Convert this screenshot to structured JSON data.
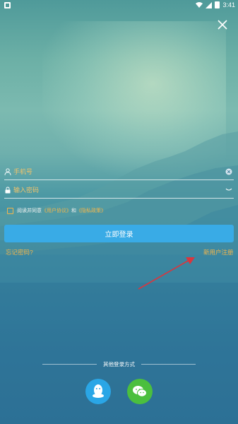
{
  "status_bar": {
    "time": "3:41"
  },
  "login_form": {
    "phone_placeholder": "手机号",
    "password_placeholder": "输入密码",
    "agreement": {
      "prefix": "阅读并同意",
      "user_agreement": "《用户协议》",
      "conjunction": "和",
      "privacy_policy": "《隐私政策》"
    },
    "login_button": "立即登录",
    "forgot_password": "忘记密码?",
    "register": "新用户注册"
  },
  "other_login": {
    "title": "其他登录方式",
    "methods": [
      {
        "name": "qq",
        "color": "#2aa6e6"
      },
      {
        "name": "wechat",
        "color": "#4bbf3e"
      }
    ]
  },
  "colors": {
    "accent": "#39abe6",
    "link": "#f2b54c",
    "arrow": "#d9363e"
  }
}
